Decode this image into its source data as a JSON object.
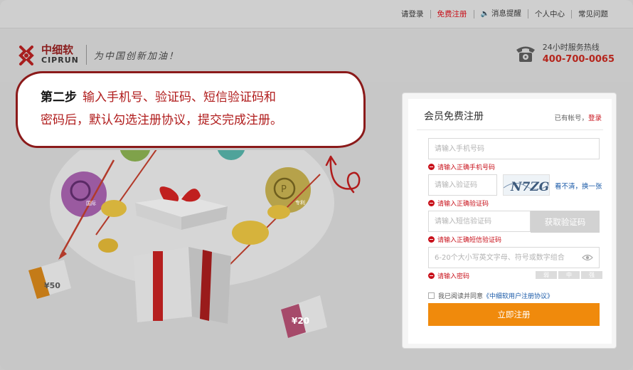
{
  "topnav": {
    "login": "请登录",
    "register": "免费注册",
    "messages": "消息提醒",
    "profile": "个人中心",
    "faq": "常见问题"
  },
  "logo": {
    "cn": "中细软",
    "en": "CIPRUN",
    "slogan": "为中国创新加油！"
  },
  "hotline": {
    "label": "24小时服务热线",
    "number": "400-700-0065"
  },
  "banner": {
    "step": "第二步",
    "line1": "输入手机号、验证码、短信验证码和",
    "line2": "密码后，默认勾选注册协议，提交完成注册。",
    "icon_labels": [
      "国际",
      "专利"
    ],
    "coupons": [
      "¥50",
      "¥20"
    ]
  },
  "form": {
    "title": "会员免费注册",
    "have_account": "已有帐号，",
    "login_link": "登录",
    "phone_placeholder": "请输入手机号码",
    "phone_error": "请输入正确手机号码",
    "code_placeholder": "请输入验证码",
    "captcha_text": "N7ZG",
    "refresh": "看不清，换一张",
    "code_error": "请输入正确验证码",
    "sms_placeholder": "请输入短信验证码",
    "sms_button": "获取验证码",
    "sms_error": "请输入正确短信验证码",
    "password_placeholder": "6-20个大小写英文字母、符号或数字组合",
    "password_error": "请输入密码",
    "strength": [
      "弱",
      "中",
      "强"
    ],
    "agree_prefix": "我已阅读并同意",
    "agree_link": "《中细软用户注册协议》",
    "submit": "立即注册"
  },
  "colors": {
    "brand_red": "#c8101a",
    "submit_orange": "#f08a0c",
    "link_blue": "#1a5aa8"
  }
}
